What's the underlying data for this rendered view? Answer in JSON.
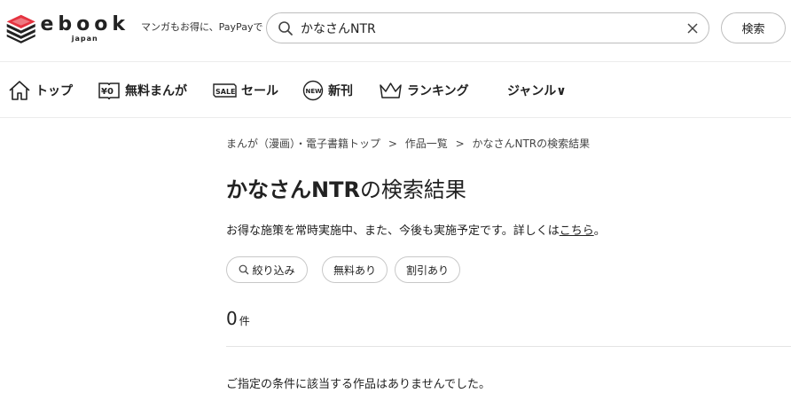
{
  "header": {
    "logo_word": "ebook",
    "logo_sub": "japan",
    "tagline": "マンガもお得に、PayPayで",
    "search_value": "かなさんNTR",
    "search_button": "検索"
  },
  "nav": {
    "items": [
      {
        "label": "トップ",
        "icon": "home-icon"
      },
      {
        "label": "無料まんが",
        "icon": "free-yen-icon"
      },
      {
        "label": "セール",
        "icon": "sale-icon"
      },
      {
        "label": "新刊",
        "icon": "new-icon"
      },
      {
        "label": "ランキング",
        "icon": "crown-icon"
      },
      {
        "label": "ジャンル∨",
        "icon": "chevron-down-icon"
      }
    ]
  },
  "breadcrumb": {
    "items": [
      "まんが（漫画）・電子書籍トップ",
      "作品一覧",
      "かなさんNTRの検索結果"
    ],
    "separator": ">"
  },
  "main": {
    "title_keyword": "かなさんNTR",
    "title_suffix": "の検索結果",
    "notice_text": "お得な施策を常時実施中、また、今後も実施予定です。詳しくは",
    "notice_link": "こちら",
    "notice_end": "。",
    "filters": [
      "絞り込み",
      "無料あり",
      "割引あり"
    ],
    "result_count": "0",
    "result_unit": "件",
    "empty_message": "ご指定の条件に該当する作品はありませんでした。"
  },
  "colors": {
    "logo_red": "#e53340",
    "border": "#bdbdbd",
    "text": "#222222"
  }
}
